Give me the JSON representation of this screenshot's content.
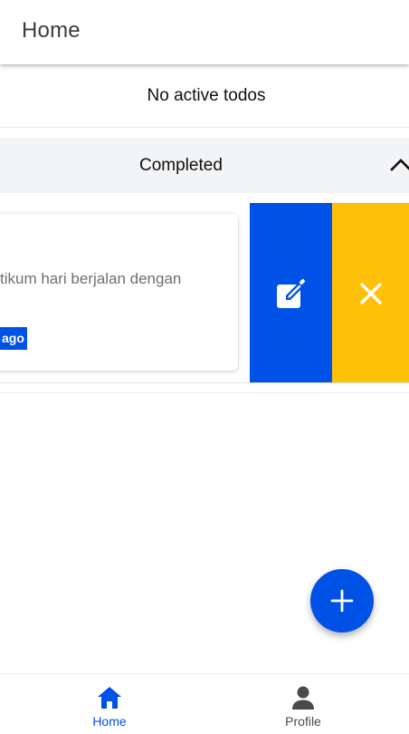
{
  "appbar": {
    "title": "Home"
  },
  "empty_state": {
    "text": "No active todos"
  },
  "completed_section": {
    "title": "Completed",
    "expanded": true,
    "icon": "chevron-up-icon"
  },
  "todo_card": {
    "description": "tikum hari berjalan dengan",
    "tag": "ago",
    "actions": {
      "edit_icon": "edit-icon",
      "delete_icon": "close-icon"
    }
  },
  "fab": {
    "icon": "plus-icon"
  },
  "bottom_nav": {
    "items": [
      {
        "label": "Home",
        "icon": "home-icon",
        "active": true
      },
      {
        "label": "Profile",
        "icon": "person-icon",
        "active": false
      }
    ]
  },
  "colors": {
    "primary": "#0051e6",
    "delete": "#ffc107",
    "section_bg": "#f3f4f6"
  }
}
